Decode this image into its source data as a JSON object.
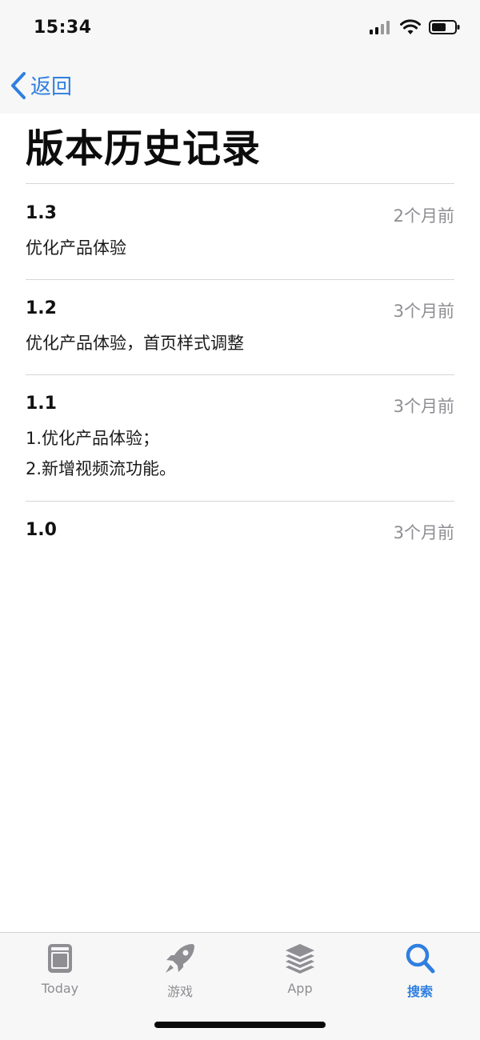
{
  "status_bar": {
    "time": "15:34"
  },
  "nav": {
    "back_label": "返回"
  },
  "page": {
    "title": "版本历史记录"
  },
  "versions": [
    {
      "number": "1.3",
      "date": "2个月前",
      "notes": [
        "优化产品体验"
      ]
    },
    {
      "number": "1.2",
      "date": "3个月前",
      "notes": [
        "优化产品体验，首页样式调整"
      ]
    },
    {
      "number": "1.1",
      "date": "3个月前",
      "notes": [
        "1.优化产品体验；",
        "2.新增视频流功能。"
      ]
    },
    {
      "number": "1.0",
      "date": "3个月前",
      "notes": []
    }
  ],
  "tab_bar": {
    "items": [
      {
        "label": "Today",
        "icon": "today-icon",
        "active": false
      },
      {
        "label": "游戏",
        "icon": "rocket-icon",
        "active": false
      },
      {
        "label": "App",
        "icon": "app-stack-icon",
        "active": false
      },
      {
        "label": "搜索",
        "icon": "search-icon",
        "active": true
      }
    ]
  },
  "colors": {
    "accent": "#2f7fe0",
    "secondary_text": "#8e8e93",
    "bar_background": "#f7f7f7"
  }
}
